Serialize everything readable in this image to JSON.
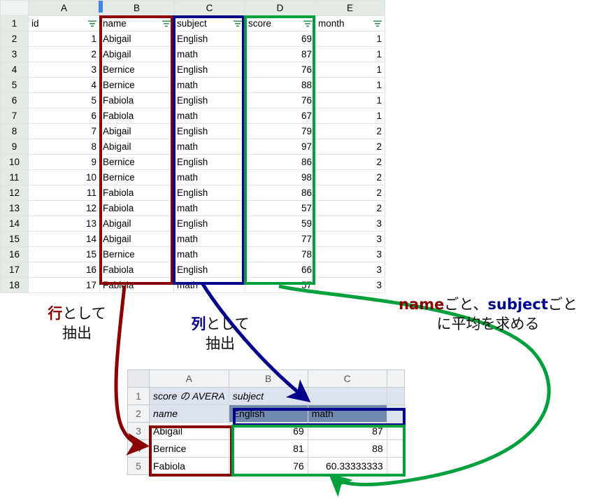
{
  "main_sheet": {
    "name": "source-data-sheet",
    "column_headers": [
      "A",
      "B",
      "C",
      "D",
      "E"
    ],
    "row_numbers": [
      "1",
      "2",
      "3",
      "4",
      "5",
      "6",
      "7",
      "8",
      "9",
      "10",
      "11",
      "12",
      "13",
      "14",
      "15",
      "16",
      "17",
      "18"
    ],
    "header_row": {
      "id": "id",
      "name": "name",
      "subject": "subject",
      "score": "score",
      "month": "month"
    },
    "filter_icon": "filter-icon",
    "rows": [
      {
        "id": "1",
        "name": "Abigail",
        "subject": "English",
        "score": "69",
        "month": "1"
      },
      {
        "id": "2",
        "name": "Abigail",
        "subject": "math",
        "score": "87",
        "month": "1"
      },
      {
        "id": "3",
        "name": "Bernice",
        "subject": "English",
        "score": "76",
        "month": "1"
      },
      {
        "id": "4",
        "name": "Bernice",
        "subject": "math",
        "score": "88",
        "month": "1"
      },
      {
        "id": "5",
        "name": "Fabiola",
        "subject": "English",
        "score": "76",
        "month": "1"
      },
      {
        "id": "6",
        "name": "Fabiola",
        "subject": "math",
        "score": "67",
        "month": "1"
      },
      {
        "id": "7",
        "name": "Abigail",
        "subject": "English",
        "score": "79",
        "month": "2"
      },
      {
        "id": "8",
        "name": "Abigail",
        "subject": "math",
        "score": "97",
        "month": "2"
      },
      {
        "id": "9",
        "name": "Bernice",
        "subject": "English",
        "score": "86",
        "month": "2"
      },
      {
        "id": "10",
        "name": "Bernice",
        "subject": "math",
        "score": "98",
        "month": "2"
      },
      {
        "id": "11",
        "name": "Fabiola",
        "subject": "English",
        "score": "86",
        "month": "2"
      },
      {
        "id": "12",
        "name": "Fabiola",
        "subject": "math",
        "score": "57",
        "month": "2"
      },
      {
        "id": "13",
        "name": "Abigail",
        "subject": "English",
        "score": "59",
        "month": "3"
      },
      {
        "id": "14",
        "name": "Abigail",
        "subject": "math",
        "score": "77",
        "month": "3"
      },
      {
        "id": "15",
        "name": "Bernice",
        "subject": "math",
        "score": "78",
        "month": "3"
      },
      {
        "id": "16",
        "name": "Fabiola",
        "subject": "English",
        "score": "66",
        "month": "3"
      },
      {
        "id": "17",
        "name": "Fabiola",
        "subject": "math",
        "score": "57",
        "month": "3"
      }
    ]
  },
  "pivot_sheet": {
    "name": "pivot-table-sheet",
    "column_headers": [
      "A",
      "B",
      "C"
    ],
    "row_numbers": [
      "1",
      "2",
      "3",
      "4",
      "5"
    ],
    "title_cell": "score の AVERA",
    "title_overflow": "subject",
    "name_cell": "name",
    "subject_headers": [
      "English",
      "math"
    ],
    "rows": [
      {
        "name": "Abigail",
        "english": "69",
        "math": "87"
      },
      {
        "name": "Bernice",
        "english": "81",
        "math": "88"
      },
      {
        "name": "Fabiola",
        "english": "76",
        "math": "60.33333333"
      }
    ]
  },
  "annotations": {
    "row_extract": {
      "keyword": "行",
      "rest": "として",
      "line2": "抽出"
    },
    "col_extract": {
      "keyword": "列",
      "rest": "として",
      "line2": "抽出"
    },
    "average": {
      "kw1": "name",
      "mid": "ごと、",
      "kw2": "subject",
      "tail": "ごと",
      "line2": "に平均を求める"
    }
  },
  "colors": {
    "red": "#8b0000",
    "blue": "#00008b",
    "green": "#00a03c",
    "selector_blue": "#4285f4",
    "pivot_header_fill": "#7189ae",
    "pivot_title_fill": "#dde3ee"
  }
}
